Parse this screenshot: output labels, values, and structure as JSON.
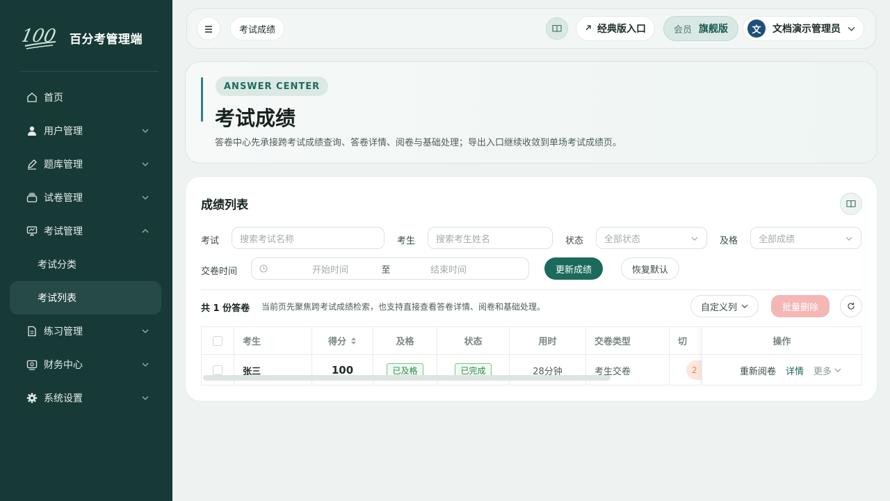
{
  "brand": {
    "name": "百分考管理端",
    "logo_text": "100"
  },
  "sidebar": {
    "items": [
      {
        "label": "首页",
        "icon": "home-icon"
      },
      {
        "label": "用户管理",
        "icon": "user-icon"
      },
      {
        "label": "题库管理",
        "icon": "pen-icon"
      },
      {
        "label": "试卷管理",
        "icon": "layers-icon"
      },
      {
        "label": "考试管理",
        "icon": "monitor-icon",
        "expanded": true
      },
      {
        "label": "考试分类",
        "sub": true
      },
      {
        "label": "考试列表",
        "sub": true,
        "active": true
      },
      {
        "label": "练习管理",
        "icon": "document-icon"
      },
      {
        "label": "财务中心",
        "icon": "wallet-icon"
      },
      {
        "label": "系统设置",
        "icon": "gear-icon"
      }
    ]
  },
  "topbar": {
    "breadcrumb": "考试成绩",
    "classic_label": "经典版入口",
    "member_label": "会员",
    "member_level": "旗舰版",
    "avatar_text": "文",
    "user_name": "文档演示管理员"
  },
  "hero": {
    "tag": "ANSWER CENTER",
    "title": "考试成绩",
    "description": "答卷中心先承接跨考试成绩查询、答卷详情、阅卷与基础处理；导出入口继续收敛到单场考试成绩页。"
  },
  "list": {
    "title": "成绩列表",
    "filters": {
      "exam_label": "考试",
      "exam_placeholder": "搜索考试名称",
      "student_label": "考生",
      "student_placeholder": "搜索考生姓名",
      "status_label": "状态",
      "status_value": "全部状态",
      "pass_label": "及格",
      "pass_value": "全部成绩",
      "time_label": "交卷时间",
      "start_placeholder": "开始时间",
      "to_text": "至",
      "end_placeholder": "结束时间",
      "update_button": "更新成绩",
      "reset_button": "恢复默认"
    },
    "count_text": "共 1 份答卷",
    "hint_text": "当前页先聚焦跨考试成绩检索，也支持直接查看答卷详情、阅卷和基础处理。",
    "custom_columns": "自定义列",
    "batch_delete": "批量删除",
    "columns": [
      "考生",
      "得分",
      "及格",
      "状态",
      "用时",
      "交卷类型",
      "切",
      "操作"
    ],
    "rows": [
      {
        "student": "张三",
        "score": "100",
        "pass": "已及格",
        "status": "已完成",
        "duration": "28分钟",
        "submit_type": "考生交卷",
        "cut": "2",
        "ops": {
          "regrade": "重新阅卷",
          "detail": "详情",
          "more": "更多"
        }
      }
    ]
  },
  "colors": {
    "sidebar_bg": "#173a36",
    "primary": "#1b6a5b",
    "danger_light": "#f4b7b5",
    "accent_bar": "#2f7f83"
  }
}
